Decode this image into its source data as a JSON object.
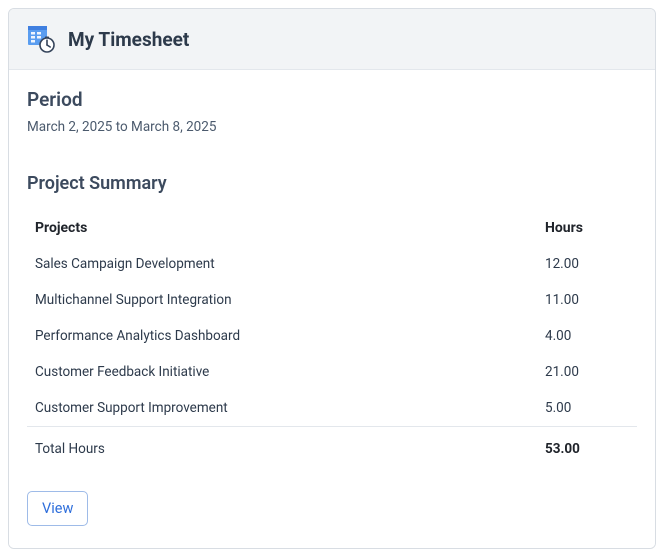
{
  "header": {
    "title": "My Timesheet"
  },
  "period": {
    "label": "Period",
    "value": "March 2, 2025 to March 8, 2025"
  },
  "summary": {
    "title": "Project Summary",
    "columns": {
      "projects": "Projects",
      "hours": "Hours"
    },
    "rows": [
      {
        "project": "Sales Campaign Development",
        "hours": "12.00"
      },
      {
        "project": "Multichannel Support Integration",
        "hours": "11.00"
      },
      {
        "project": "Performance Analytics Dashboard",
        "hours": "4.00"
      },
      {
        "project": "Customer Feedback Initiative",
        "hours": "21.00"
      },
      {
        "project": "Customer Support Improvement",
        "hours": "5.00"
      }
    ],
    "total": {
      "label": "Total Hours",
      "hours": "53.00"
    }
  },
  "actions": {
    "view": "View"
  }
}
